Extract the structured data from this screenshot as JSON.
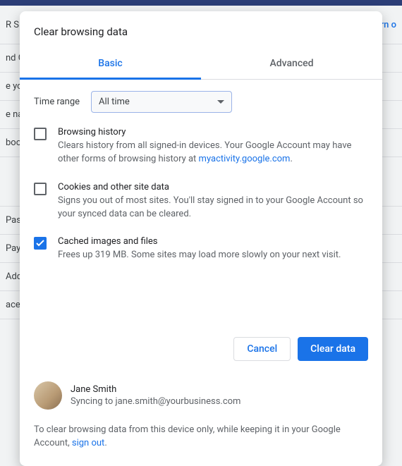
{
  "background": {
    "rows": [
      {
        "left": "R\nS",
        "right": "Turn o"
      },
      {
        "left": "nd G",
        "right": ""
      },
      {
        "left": "e yo",
        "right": ""
      },
      {
        "left": "e na",
        "right": ""
      },
      {
        "left": "boo",
        "right": ""
      },
      {
        "left": "",
        "right": ""
      },
      {
        "left": "Pas",
        "right": ""
      },
      {
        "left": "Payr",
        "right": ""
      },
      {
        "left": "Add",
        "right": ""
      },
      {
        "left": "ace",
        "right": ""
      }
    ]
  },
  "dialog": {
    "title": "Clear browsing data",
    "tabs": {
      "basic": "Basic",
      "advanced": "Advanced",
      "active": "basic"
    },
    "time_range": {
      "label": "Time range",
      "value": "All time"
    },
    "options": [
      {
        "checked": false,
        "title": "Browsing history",
        "desc_pre": "Clears history from all signed-in devices. Your Google Account may have other forms of browsing history at ",
        "link": "myactivity.google.com",
        "desc_post": "."
      },
      {
        "checked": false,
        "title": "Cookies and other site data",
        "desc": "Signs you out of most sites. You'll stay signed in to your Google Account so your synced data can be cleared."
      },
      {
        "checked": true,
        "title": "Cached images and files",
        "desc": "Frees up 319 MB. Some sites may load more slowly on your next visit."
      }
    ],
    "buttons": {
      "cancel": "Cancel",
      "confirm": "Clear data"
    },
    "user": {
      "name": "Jane Smith",
      "syncing_label": "Syncing to",
      "email": "jane.smith@yourbusiness.com"
    },
    "footer": {
      "text_pre": "To clear browsing data from this device only, while keeping it in your Google Account, ",
      "link": "sign out",
      "text_post": "."
    }
  }
}
